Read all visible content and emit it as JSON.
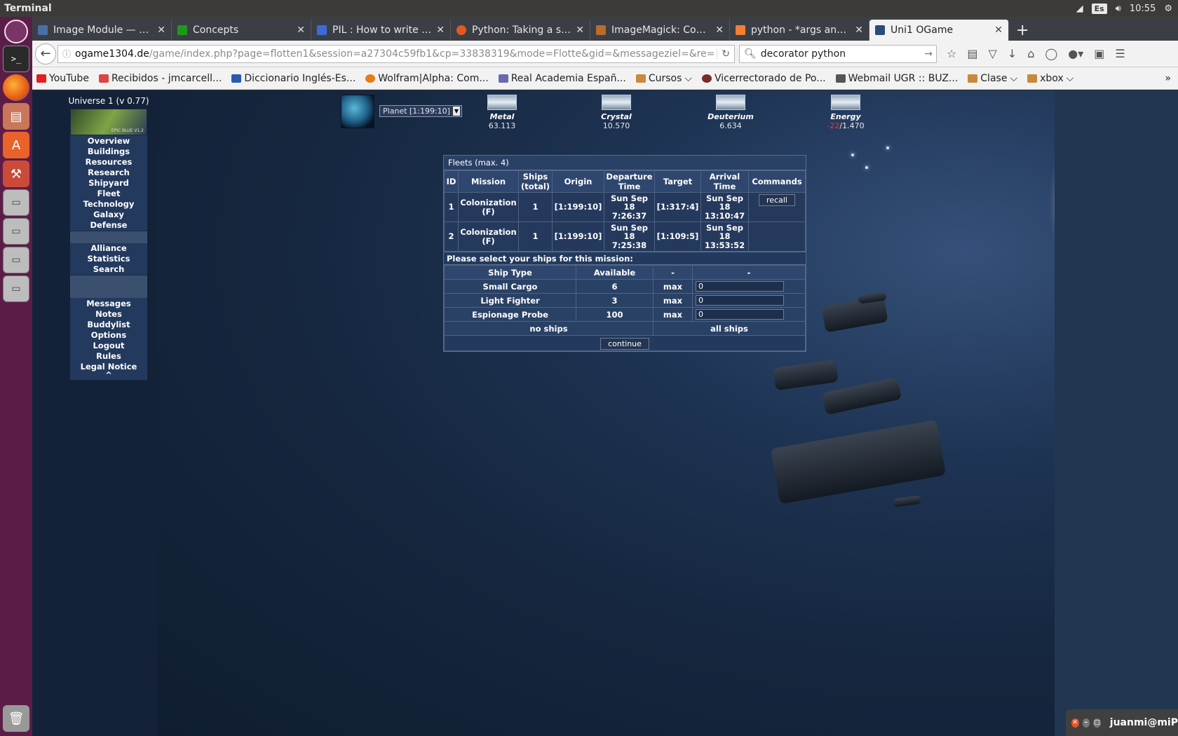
{
  "panel": {
    "app_title": "Terminal",
    "keyboard": "Es",
    "time": "10:55"
  },
  "browser": {
    "tabs": [
      {
        "label": "Image Module — Pil...",
        "color": "#4a6ea9"
      },
      {
        "label": "Concepts",
        "color": "#1d9a1d"
      },
      {
        "label": "PIL : How to write a...",
        "color": "#3b6bd6"
      },
      {
        "label": "Python: Taking a scr...",
        "color": "#e05a20"
      },
      {
        "label": "ImageMagick: Com...",
        "color": "#b86d2a"
      },
      {
        "label": "python - *args and *...",
        "color": "#f28032"
      },
      {
        "label": "Uni1 OGame",
        "color": "#2a4a7a"
      }
    ],
    "url_host": "ogame1304.de",
    "url_path": "/game/index.php?page=flotten1&session=a27304c59fb1&cp=33838319&mode=Flotte&gid=&messageziel=&re=",
    "search_text": "decorator python",
    "bookmarks": [
      {
        "label": "YouTube",
        "color": "#e02020"
      },
      {
        "label": "Recibidos - jmcarcell...",
        "color": "#d44"
      },
      {
        "label": "Diccionario Inglés-Es...",
        "color": "#2a5ab0"
      },
      {
        "label": "Wolfram|Alpha: Com...",
        "color": "#e87a1a"
      },
      {
        "label": "Real Academia Españ...",
        "color": "#6a6ab0"
      },
      {
        "label": "Cursos",
        "color": "#c88a3a"
      },
      {
        "label": "Vicerrectorado de Po...",
        "color": "#7a2a2a"
      },
      {
        "label": "Webmail UGR :: BUZ...",
        "color": "#555"
      },
      {
        "label": "Clase",
        "color": "#c88a3a"
      },
      {
        "label": "xbox",
        "color": "#c88a3a"
      }
    ]
  },
  "game": {
    "universe": "Universe 1 (v 0.77)",
    "banner_text": "EPIC BLUE V1.2",
    "menu_main": [
      "Overview",
      "Buildings",
      "Resources",
      "Research",
      "Shipyard",
      "Fleet",
      "Technology",
      "Galaxy",
      "Defense"
    ],
    "menu_social": [
      "Alliance",
      "Statistics",
      "Search"
    ],
    "menu_account": [
      "Messages",
      "Notes",
      "Buddylist",
      "Options",
      "Logout",
      "Rules",
      "Legal Notice"
    ],
    "menu_caret": "^",
    "planet_select": "Planet [1:199:10]",
    "resources": {
      "metal": {
        "name": "Metal",
        "value": "63.113"
      },
      "crystal": {
        "name": "Crystal",
        "value": "10.570"
      },
      "deuterium": {
        "name": "Deuterium",
        "value": "6.634"
      },
      "energy": {
        "name": "Energy",
        "value_neg": "-22",
        "value_rest": "/1.470"
      }
    },
    "fleets": {
      "title": "Fleets (max. 4)",
      "headers": [
        "ID",
        "Mission",
        "Ships (total)",
        "Origin",
        "Departure Time",
        "Target",
        "Arrival Time",
        "Commands"
      ],
      "rows": [
        {
          "id": "1",
          "mission": "Colonization (F)",
          "ships": "1",
          "origin": "[1:199:10]",
          "departure": "Sun Sep 18 7:26:37",
          "target": "[1:317:4]",
          "arrival": "Sun Sep 18 13:10:47",
          "command": "recall"
        },
        {
          "id": "2",
          "mission": "Colonization (F)",
          "ships": "1",
          "origin": "[1:199:10]",
          "departure": "Sun Sep 18 7:25:38",
          "target": "[1:109:5]",
          "arrival": "Sun Sep 18 13:53:52",
          "command": ""
        }
      ]
    },
    "ship_select": {
      "title": "Please select your ships for this mission:",
      "headers": [
        "Ship Type",
        "Available",
        "-",
        "-"
      ],
      "rows": [
        {
          "type": "Small Cargo",
          "available": "6",
          "max": "max",
          "qty": "0"
        },
        {
          "type": "Light Fighter",
          "available": "3",
          "max": "max",
          "qty": "0"
        },
        {
          "type": "Espionage Probe",
          "available": "100",
          "max": "max",
          "qty": "0"
        }
      ],
      "no_ships": "no ships",
      "all_ships": "all ships",
      "continue": "continue"
    }
  },
  "terminal_window": {
    "title": "juanmi@miP"
  }
}
